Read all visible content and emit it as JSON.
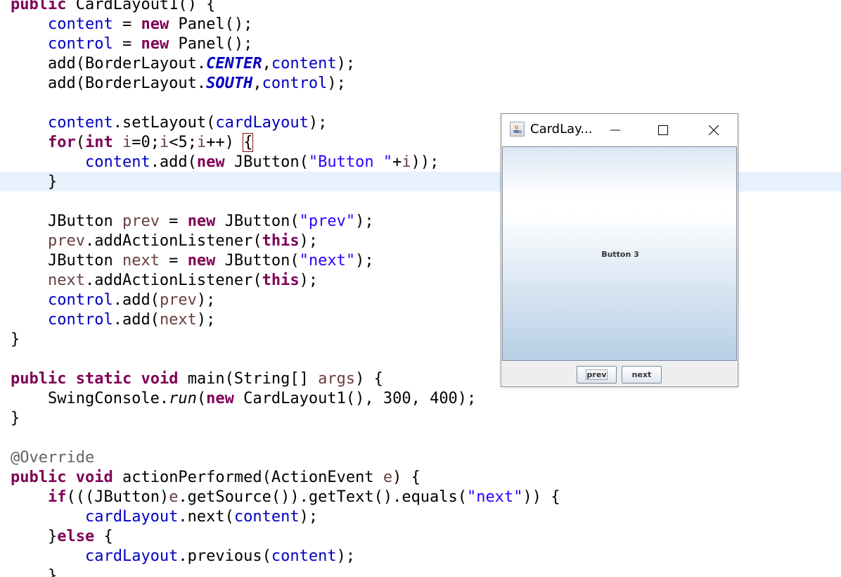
{
  "code_lines": [
    "public CardLayout1() {",
    "content = new Panel();",
    "control = new Panel();",
    "add(BorderLayout.CENTER,content);",
    "add(BorderLayout.SOUTH,control);",
    "",
    "content.setLayout(cardLayout);",
    "for(int i=0;i<5;i++) {",
    "content.add(new JButton(\"Button \"+i));",
    "}",
    "",
    "JButton prev = new JButton(\"prev\");",
    "prev.addActionListener(this);",
    "JButton next = new JButton(\"next\");",
    "next.addActionListener(this);",
    "control.add(prev);",
    "control.add(next);",
    "}",
    "",
    "public static void main(String[] args) {",
    "SwingConsole.run(new CardLayout1(), 300, 400);",
    "}",
    "",
    "@Override",
    "public void actionPerformed(ActionEvent e) {",
    "if(((JButton)e.getSource()).getText().equals(\"next\")) {",
    "cardLayout.next(content);",
    "}else {",
    "cardLayout.previous(content);",
    "}"
  ],
  "window": {
    "title": "CardLay...",
    "icon": "java-coffee-icon",
    "card_label": "Button 3",
    "prev_label": "prev",
    "next_label": "next"
  },
  "colors": {
    "keyword": "#7f0055",
    "field": "#0000c0",
    "string": "#2a00ff",
    "local": "#6a3e3e",
    "annotation": "#646464",
    "current_line": "#e8f2fe"
  }
}
